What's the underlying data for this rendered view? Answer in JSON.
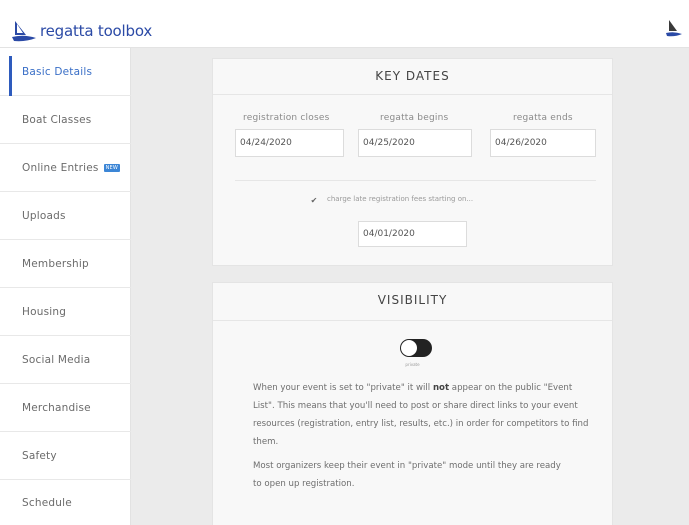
{
  "header": {
    "brand_text": "regatta toolbox"
  },
  "sidebar": {
    "items": [
      {
        "label": "Basic Details",
        "active": true
      },
      {
        "label": "Boat Classes"
      },
      {
        "label": "Online Entries",
        "badge": "NEW"
      },
      {
        "label": "Uploads"
      },
      {
        "label": "Membership"
      },
      {
        "label": "Housing"
      },
      {
        "label": "Social Media"
      },
      {
        "label": "Merchandise"
      },
      {
        "label": "Safety"
      },
      {
        "label": "Schedule"
      }
    ]
  },
  "key_dates": {
    "title": "KEY DATES",
    "registration_closes_label": "registration closes",
    "registration_closes_value": "04/24/2020",
    "regatta_begins_label": "regatta begins",
    "regatta_begins_value": "04/25/2020",
    "regatta_ends_label": "regatta ends",
    "regatta_ends_value": "04/26/2020",
    "late_fee_checked": true,
    "late_fee_label": "charge late registration fees starting on...",
    "late_fee_value": "04/01/2020"
  },
  "visibility": {
    "title": "VISIBILITY",
    "toggle_caption": "private",
    "paragraph1_before": "When your event is set to \"private\" it will ",
    "paragraph1_bold": "not",
    "paragraph1_after": " appear on the public \"Event List\". This means that you'll need to post or share direct links to your event resources (registration, entry list, results, etc.) in order for competitors to find them.",
    "paragraph2": "Most organizers keep their event in \"private\" mode until they are ready to open up registration."
  },
  "colors": {
    "brand": "#2b4aa6",
    "active_nav": "#3a6fc7",
    "badge": "#3c86d6",
    "toggle": "#222222"
  }
}
